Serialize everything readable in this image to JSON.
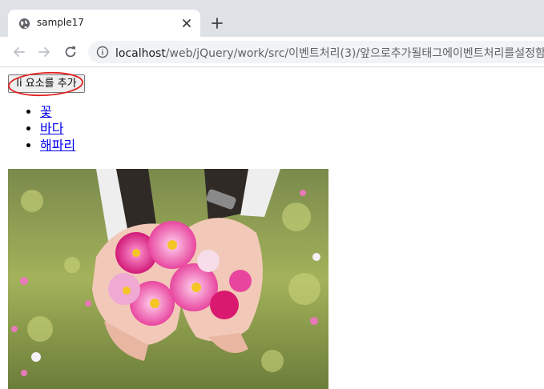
{
  "browser": {
    "tab_title": "sample17",
    "url_host": "localhost",
    "url_path": "/web/jQuery/work/src/이벤트처리(3)/앞으로추가될태그에이벤트처리를설정함"
  },
  "page": {
    "add_button_label": "li 요소를 추가",
    "list_items": [
      "꽃",
      "바다",
      "해파리"
    ]
  }
}
